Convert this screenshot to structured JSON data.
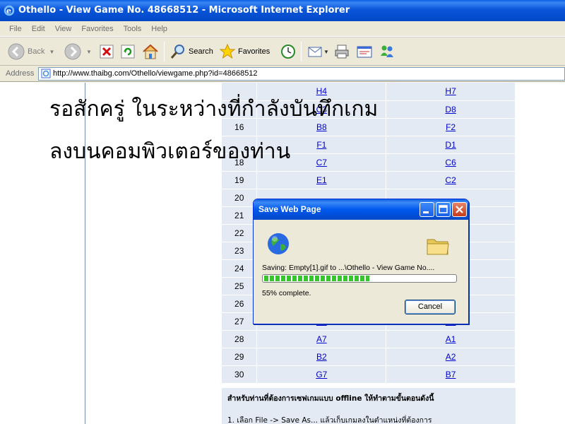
{
  "window": {
    "title": "Othello - View Game No. 48668512 - Microsoft Internet Explorer"
  },
  "menu": [
    "File",
    "Edit",
    "View",
    "Favorites",
    "Tools",
    "Help"
  ],
  "toolbar": {
    "back": "Back",
    "search": "Search",
    "favorites": "Favorites"
  },
  "address": {
    "label": "Address",
    "url": "http://www.thaibg.com/Othello/viewgame.php?id=48668512"
  },
  "overlay": {
    "line1": "รอสักครู่ ในระหว่างที่กำลังบันทึกเกม",
    "line2": "ลงบนคอมพิวเตอร์ของท่าน"
  },
  "moves": [
    {
      "n": "",
      "black": "H4",
      "white": "H7"
    },
    {
      "n": "",
      "black": "C3",
      "white": "D8"
    },
    {
      "n": "16",
      "black": "B8",
      "white": "F2"
    },
    {
      "n": "",
      "black": "F1",
      "white": "D1"
    },
    {
      "n": "18",
      "black": "C7",
      "white": "C6"
    },
    {
      "n": "19",
      "black": "E1",
      "white": "C2"
    },
    {
      "n": "20",
      "black": "",
      "white": ""
    },
    {
      "n": "21",
      "black": "",
      "white": ""
    },
    {
      "n": "22",
      "black": "",
      "white": ""
    },
    {
      "n": "23",
      "black": "",
      "white": ""
    },
    {
      "n": "24",
      "black": "",
      "white": ""
    },
    {
      "n": "25",
      "black": "",
      "white": ""
    },
    {
      "n": "26",
      "black": "",
      "white": ""
    },
    {
      "n": "27",
      "black": "B5",
      "white": "A8"
    },
    {
      "n": "28",
      "black": "A7",
      "white": "A1"
    },
    {
      "n": "29",
      "black": "B2",
      "white": "A2"
    },
    {
      "n": "30",
      "black": "G7",
      "white": "B7"
    }
  ],
  "notes": {
    "heading": "สำหรับท่านที่ต้องการเซฟเกมแบบ offline ให้ทำตามขั้นตอนดังนี้",
    "step1": "1. เลือก File -> Save As... แล้วเก็บเกมลงในตำแหน่งที่ต้องการ"
  },
  "dialog": {
    "title": "Save Web Page",
    "saving": "Saving: Empty[1].gif to ...\\Othello - View Game No....",
    "progress": 0.55,
    "percent_text": "55% complete.",
    "cancel": "Cancel"
  }
}
